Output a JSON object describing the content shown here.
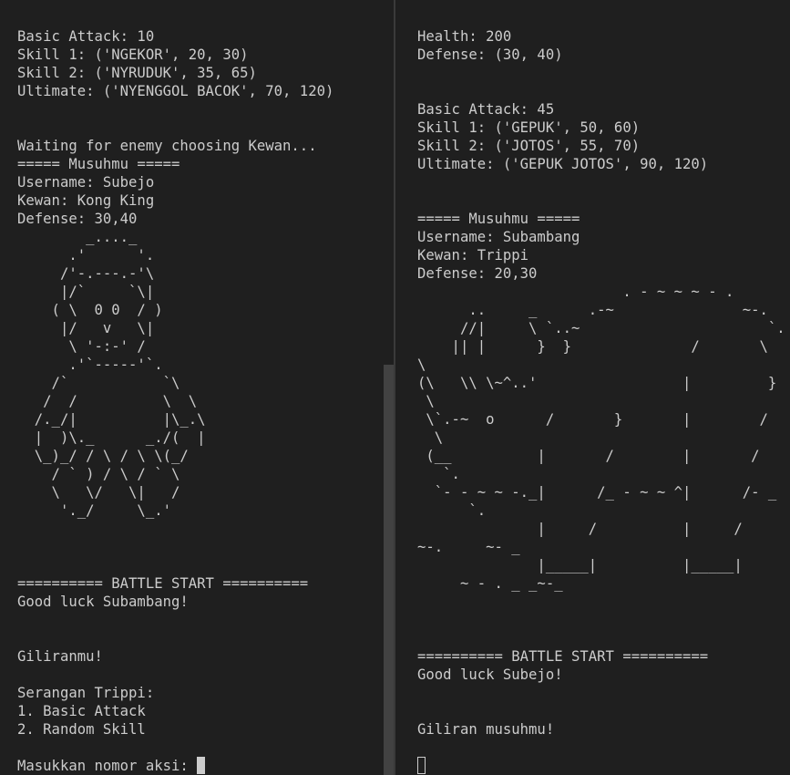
{
  "left_terminal": {
    "lines": [
      "Basic Attack: 10",
      "Skill 1: ('NGEKOR', 20, 30)",
      "Skill 2: ('NYRUDUK', 35, 65)",
      "Ultimate: ('NYENGGOL BACOK', 70, 120)",
      "",
      "",
      "Waiting for enemy choosing Kewan...",
      "===== Musuhmu =====",
      "Username: Subejo",
      "Kewan: Kong King",
      "Defense: 30,40",
      "        _...._",
      "      .'      '.",
      "     /'-.---.-'\\",
      "     |/`     `\\|",
      "    ( \\  0 0  / )",
      "     |/   v   \\|",
      "      \\ '-:-' /",
      "      .'`-----'`.",
      "    /`           `\\",
      "   /  /          \\  \\",
      "  /._/|          |\\_.\\",
      "  |  )\\._      _./(  |",
      "  \\_)_/ / \\ / \\ \\(_/",
      "    / ` ) / \\ / ` \\",
      "    \\   \\/   \\|   /",
      "     '._/     \\_.'",
      "",
      "",
      "",
      "========== BATTLE START ==========",
      "Good luck Subambang!",
      "",
      "",
      "Giliranmu!",
      "",
      "Serangan Trippi:",
      "1. Basic Attack",
      "2. Random Skill",
      "",
      "Masukkan nomor aksi: "
    ]
  },
  "right_terminal": {
    "lines": [
      "Health: 200",
      "Defense: (30, 40)",
      "",
      "",
      "Basic Attack: 45",
      "Skill 1: ('GEPUK', 50, 60)",
      "Skill 2: ('JOTOS', 55, 70)",
      "Ultimate: ('GEPUK JOTOS', 90, 120)",
      "",
      "",
      "===== Musuhmu =====",
      "Username: Subambang",
      "Kewan: Trippi",
      "Defense: 20,30",
      "                        . - ~ ~ ~ - .",
      "      ..     _      .-~               ~-.",
      "     //|     \\ `..~                      `.",
      "    || |      }  }              /       \\",
      "\\",
      "(\\   \\\\ \\~^..'                 |         }",
      " \\",
      " \\`.-~  o      /       }       |        /",
      "  \\",
      " (__          |       /        |       /",
      "   `.",
      "  `- - ~ ~ -._|      /_ - ~ ~ ^|      /- _",
      "      `.",
      "              |     /          |     /",
      "~-.     ~- _",
      "              |_____|          |_____|",
      "     ~ - . _ _~-_",
      "",
      "",
      "",
      "========== BATTLE START ==========",
      "Good luck Subejo!",
      "",
      "",
      "Giliran musuhmu!",
      "",
      ""
    ]
  }
}
